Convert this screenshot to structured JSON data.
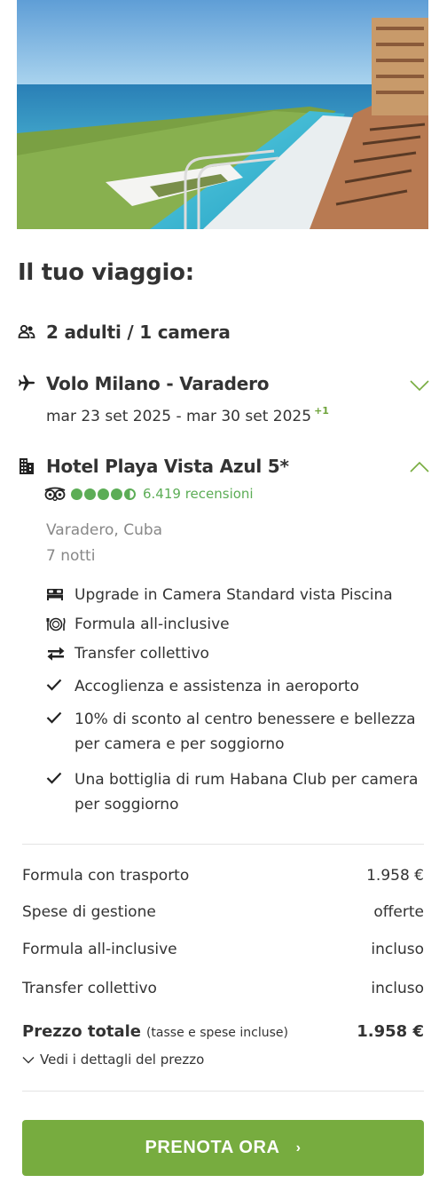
{
  "trip": {
    "title": "Il tuo viaggio:",
    "guests": "2 adulti / 1 camera"
  },
  "flight": {
    "title": "Volo Milano - Varadero",
    "dates": "mar 23 set 2025 - mar 30 set 2025",
    "day_offset": "+1"
  },
  "hotel": {
    "title": "Hotel Playa Vista Azul 5*",
    "rating_value": 4.5,
    "rating_max": 5,
    "reviews": "6.419 recensioni",
    "location": "Varadero, Cuba",
    "nights": "7 notti",
    "features": [
      {
        "icon": "bed-icon",
        "text": "Upgrade in Camera Standard vista Piscina"
      },
      {
        "icon": "plate-cutlery-icon",
        "text": "Formula all-inclusive"
      },
      {
        "icon": "transfer-arrows-icon",
        "text": "Transfer collettivo"
      },
      {
        "icon": "check-icon",
        "text": "Accoglienza e assistenza in aeroporto"
      },
      {
        "icon": "check-icon",
        "text": "10% di sconto al centro benessere e bellezza per camera e per soggiorno"
      },
      {
        "icon": "check-icon",
        "text": "Una bottiglia di rum Habana Club per camera per soggiorno"
      }
    ]
  },
  "prices": {
    "rows": [
      {
        "label": "Formula con trasporto",
        "value": "1.958 €"
      },
      {
        "label": "Spese di gestione",
        "value": "offerte"
      },
      {
        "label": "Formula all-inclusive",
        "value": "incluso"
      },
      {
        "label": "Transfer collettivo",
        "value": "incluso"
      }
    ],
    "total_label": "Prezzo totale",
    "total_note": "(tasse e spese incluse)",
    "total_value": "1.958 €",
    "details_link": "Vedi i dettagli del prezzo"
  },
  "cta": {
    "label": "PRENOTA ORA"
  },
  "colors": {
    "accent_green": "#77ac3f",
    "rating_green": "#5cad56",
    "text": "#333333",
    "muted": "#888888"
  }
}
